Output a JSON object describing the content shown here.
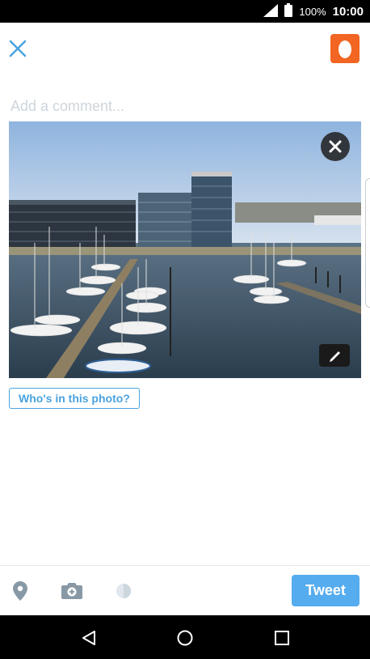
{
  "status_bar": {
    "battery": "100%",
    "time": "10:00",
    "icons": [
      "signal-icon",
      "battery-icon"
    ]
  },
  "compose": {
    "close_icon": "close-icon",
    "comment_placeholder": "Add a comment...",
    "tag_button_label": "Who's in this photo?",
    "photo_description_icons": [
      "remove-photo-icon",
      "edit-photo-icon"
    ]
  },
  "toolbar": {
    "icons": [
      "location-icon",
      "camera-icon",
      "gif-icon"
    ],
    "tweet_label": "Tweet"
  },
  "nav": {
    "icons": [
      "back-icon",
      "home-icon",
      "recents-icon"
    ]
  },
  "colors": {
    "accent": "#55acee",
    "link": "#4aa3df",
    "avatar": "#f26522"
  }
}
